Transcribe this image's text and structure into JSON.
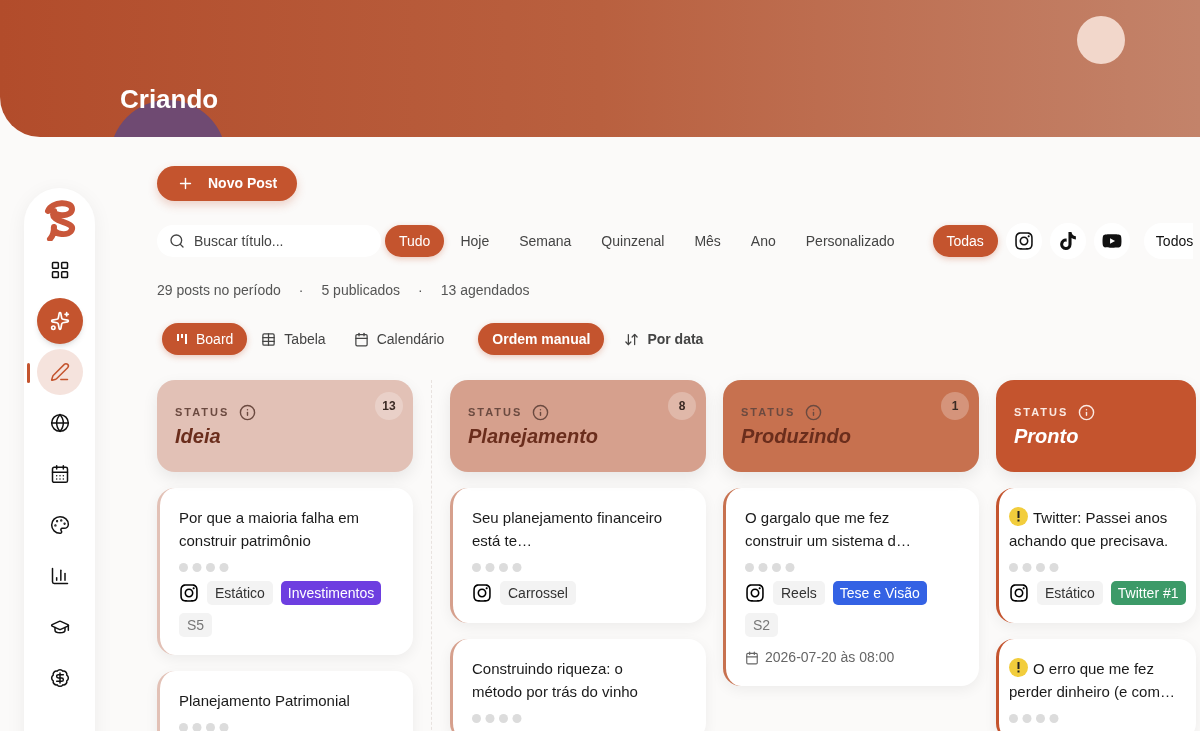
{
  "header": {
    "title": "Criando"
  },
  "sidebar": {
    "items": [
      {
        "kind": "dashboard",
        "selected": false
      },
      {
        "kind": "ai",
        "selected": false
      },
      {
        "kind": "editor",
        "selected": true
      },
      {
        "kind": "globe",
        "selected": false
      },
      {
        "kind": "calendar",
        "selected": false
      },
      {
        "kind": "palette",
        "selected": false
      },
      {
        "kind": "chart",
        "selected": false
      },
      {
        "kind": "learn",
        "selected": false
      },
      {
        "kind": "money",
        "selected": false
      }
    ]
  },
  "new_post_button": {
    "label": "Novo Post"
  },
  "search": {
    "placeholder": "Buscar título..."
  },
  "periods": [
    {
      "label": "Tudo",
      "selected": true
    },
    {
      "label": "Hoje",
      "selected": false
    },
    {
      "label": "Semana",
      "selected": false
    },
    {
      "label": "Quinzenal",
      "selected": false
    },
    {
      "label": "Mês",
      "selected": false
    },
    {
      "label": "Ano",
      "selected": false
    },
    {
      "label": "Personalizado",
      "selected": false
    }
  ],
  "platforms": [
    {
      "kind": "all",
      "label": "Todas",
      "selected": true
    },
    {
      "kind": "instagram",
      "selected": false
    },
    {
      "kind": "tiktok",
      "selected": false
    },
    {
      "kind": "youtube",
      "selected": false
    }
  ],
  "account_filter": {
    "label": "Todos"
  },
  "stats": {
    "separator": "·",
    "items": [
      "29 posts no período",
      "5 publicados",
      "13 agendados"
    ]
  },
  "views": [
    {
      "kind": "board",
      "label": "Board",
      "selected": true
    },
    {
      "kind": "table",
      "label": "Tabela",
      "selected": false
    },
    {
      "kind": "calendar",
      "label": "Calendário",
      "selected": false
    }
  ],
  "sort": [
    {
      "kind": "manual",
      "label": "Ordem manual",
      "selected": true
    },
    {
      "kind": "date",
      "label": "Por data",
      "selected": false
    }
  ],
  "columns": [
    {
      "caption": "STATUS",
      "title": "Ideia",
      "count": "13",
      "color": "#e2c1b6",
      "cards": [
        {
          "title": "Por que a maioria falha em construir patrimônio",
          "warning": false,
          "tags": [
            {
              "kind": "platform"
            },
            {
              "kind": "format",
              "label": "Estático"
            },
            {
              "kind": "category",
              "label": "Investimentos",
              "color": "#6d3ee0"
            },
            {
              "kind": "series",
              "label": "S5"
            }
          ]
        },
        {
          "title": "Planejamento Patrimonial",
          "warning": false
        }
      ]
    },
    {
      "caption": "STATUS",
      "title": "Planejamento",
      "count": "8",
      "color": "#d6a08d",
      "cards": [
        {
          "title": "Seu planejamento financeiro está te…",
          "warning": false,
          "tags": [
            {
              "kind": "platform"
            },
            {
              "kind": "format",
              "label": "Carrossel"
            }
          ]
        },
        {
          "title": "Construindo riqueza: o método por trás do vinho",
          "warning": false
        }
      ]
    },
    {
      "caption": "STATUS",
      "title": "Produzindo",
      "count": "1",
      "color": "#c7714f",
      "cards": [
        {
          "title": "O gargalo que me fez construir um sistema d…",
          "warning": false,
          "tags": [
            {
              "kind": "platform"
            },
            {
              "kind": "format",
              "label": "Reels"
            },
            {
              "kind": "category",
              "label": "Tese e Visão",
              "color": "#3462e4"
            },
            {
              "kind": "series",
              "label": "S2"
            }
          ],
          "date": "2026-07-20 às 08:00"
        }
      ]
    },
    {
      "caption": "STATUS",
      "title": "Pronto",
      "color": "#c4542e",
      "cards": [
        {
          "title": "Twitter: Passei anos achando que precisava.",
          "warning": true,
          "tags": [
            {
              "kind": "platform"
            },
            {
              "kind": "format",
              "label": "Estático"
            },
            {
              "kind": "category",
              "label": "Twitter #1",
              "color": "#3c9a68"
            }
          ]
        },
        {
          "title": "O erro que me fez perder dinheiro (e com…",
          "warning": true
        }
      ]
    }
  ]
}
